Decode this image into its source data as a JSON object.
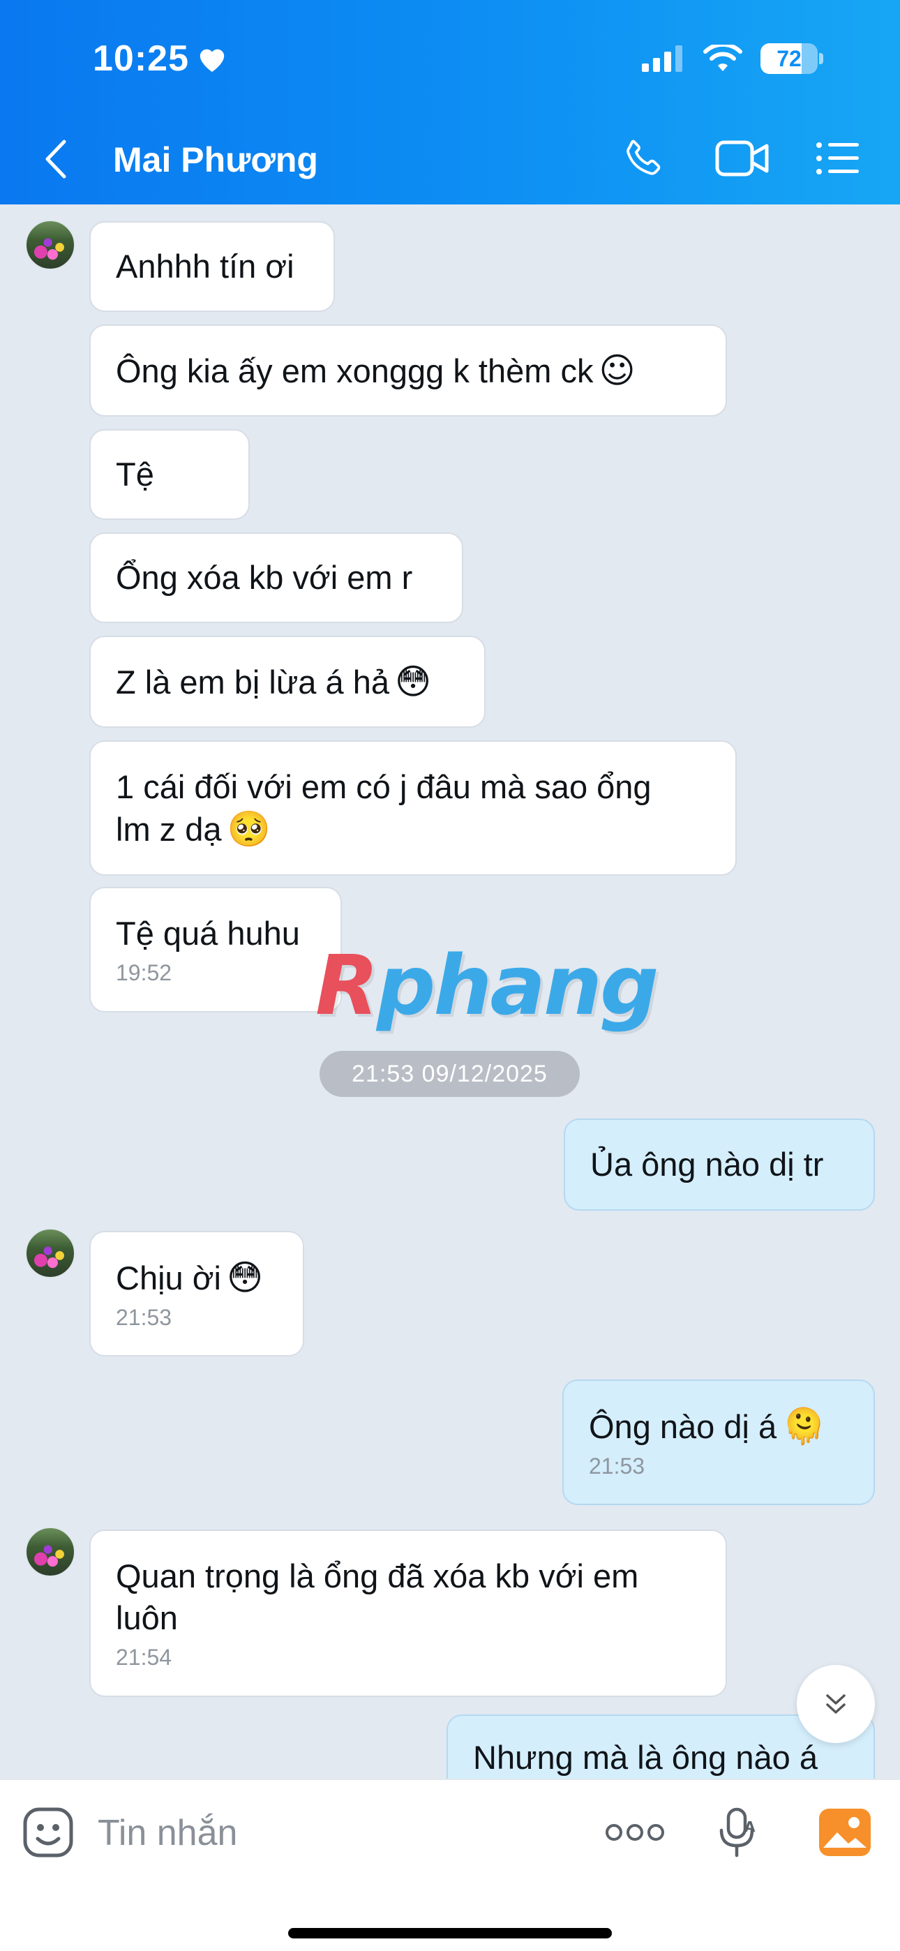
{
  "status_bar": {
    "time": "10:25",
    "battery": "72",
    "battery_level": 0.72
  },
  "header": {
    "contact_name": "Mai Phương"
  },
  "messages": [
    {
      "text": "Anhhh tín ơi"
    },
    {
      "text": "Ông kia ấy em xonggg k thèm ck",
      "emoji": "☺"
    },
    {
      "text": "Tệ"
    },
    {
      "text": "Ổng xóa kb với em r"
    },
    {
      "text": "Z là em bị lừa á hả",
      "emoji": "😳"
    },
    {
      "text": "1 cái đối với em có j đâu mà sao ổng",
      "text2": "lm z dạ",
      "emoji": "🥺"
    },
    {
      "text": "Tệ quá huhu",
      "time": "19:52"
    },
    {
      "text": "Ủa ông nào dị tr"
    },
    {
      "text": "Chịu ời",
      "emoji": "😳",
      "time": "21:53"
    },
    {
      "text": "Ông nào dị á",
      "emoji": "🫠",
      "time": "21:53"
    },
    {
      "text": "Quan trọng là ổng đã xóa kb với em",
      "text2": "luôn",
      "time": "21:54"
    },
    {
      "text": "Nhưng mà là ông nào á"
    }
  ],
  "date_separator": "21:53 09/12/2025",
  "watermark": {
    "first": "R",
    "rest": "phang"
  },
  "input": {
    "placeholder": "Tin nhắn"
  },
  "colors": {
    "header": "#0d8ff3",
    "incoming": "#ffffff",
    "outgoing": "#d4eefc",
    "background": "#e2e9f1"
  },
  "icons": [
    "back-icon",
    "phone-icon",
    "video-icon",
    "menu-icon",
    "sticker-icon",
    "more-icon",
    "voice-icon",
    "image-icon",
    "chevron-double-down-icon"
  ]
}
